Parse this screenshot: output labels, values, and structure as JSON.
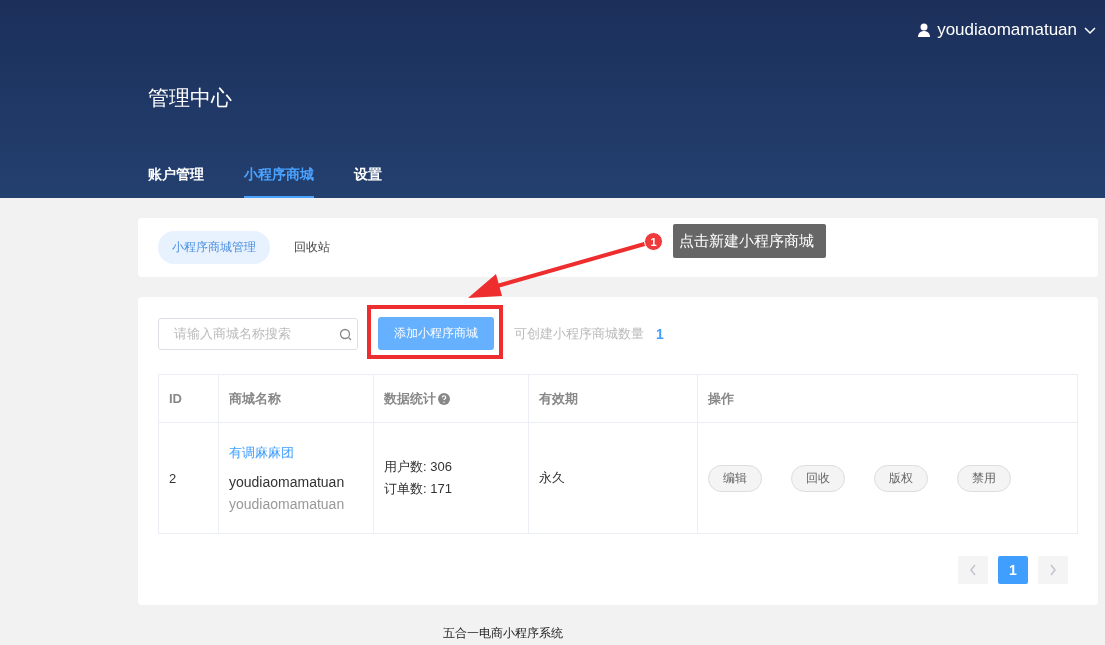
{
  "user": {
    "name": "youdiaomamatuan"
  },
  "title": "管理中心",
  "nav_tabs": [
    {
      "label": "账户管理",
      "selected": false
    },
    {
      "label": "小程序商城",
      "selected": true
    },
    {
      "label": "设置",
      "selected": false
    }
  ],
  "sub_tabs": [
    {
      "label": "小程序商城管理",
      "selected": true
    },
    {
      "label": "回收站",
      "selected": false
    }
  ],
  "annotation": {
    "badge": "1",
    "text": "点击新建小程序商城"
  },
  "search": {
    "placeholder": "请输入商城名称搜索"
  },
  "add_button": "添加小程序商城",
  "quota": {
    "label": "可创建小程序商城数量",
    "value": "1"
  },
  "table": {
    "columns": [
      "ID",
      "商城名称",
      "数据统计",
      "有效期",
      "操作"
    ],
    "rows": [
      {
        "id": "2",
        "name": "有调麻麻团",
        "owner": "youdiaomamatuan",
        "owner_sub": "youdiaomamatuan",
        "stats": [
          "用户数: 306",
          "订单数: 171"
        ],
        "validity": "永久",
        "actions": [
          "编辑",
          "回收",
          "版权",
          "禁用"
        ]
      }
    ]
  },
  "pagination": {
    "pages": [
      {
        "label": "1",
        "selected": true
      }
    ]
  },
  "footer": "五合一电商小程序系统"
}
